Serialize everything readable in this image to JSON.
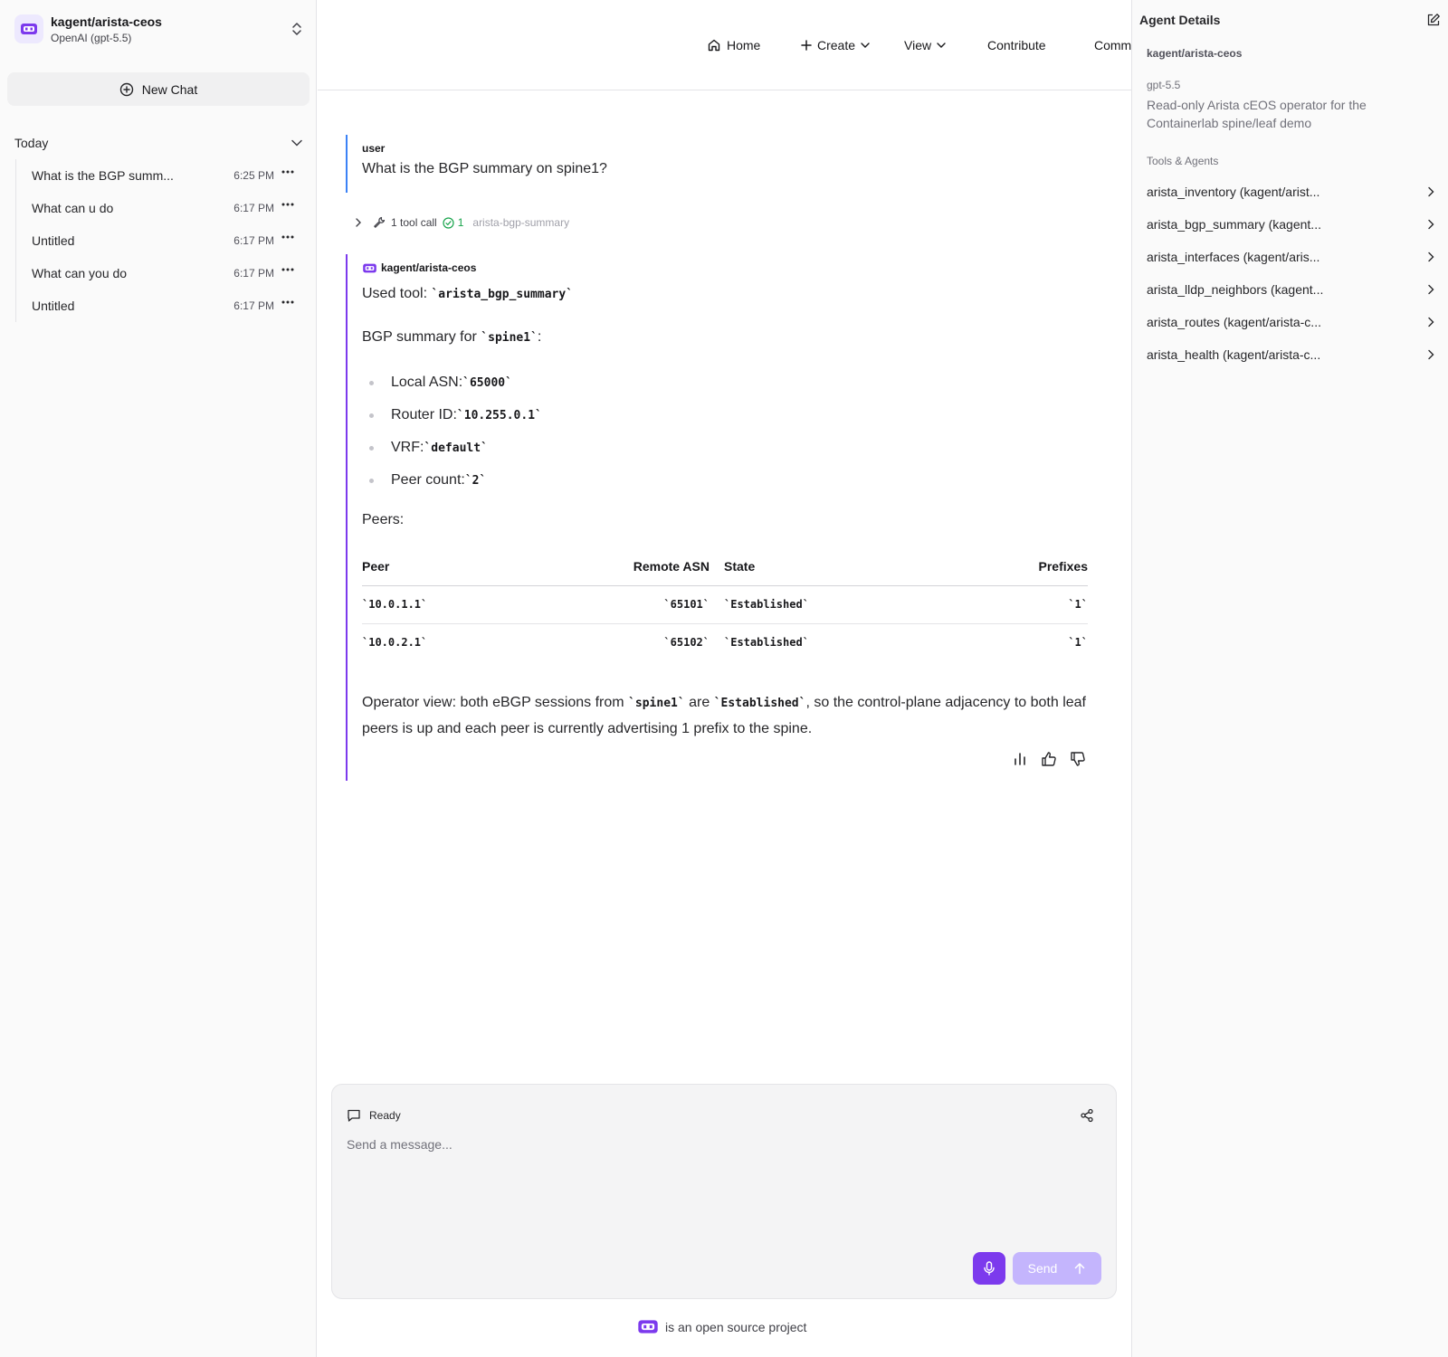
{
  "sidebar": {
    "agent_name": "kagent/arista-ceos",
    "agent_model": "OpenAI (gpt-5.5)",
    "new_chat_label": "New Chat",
    "group_label": "Today",
    "chats": [
      {
        "title": "What is the BGP summ...",
        "time": "6:25 PM"
      },
      {
        "title": "What can u do",
        "time": "6:17 PM"
      },
      {
        "title": "Untitled",
        "time": "6:17 PM"
      },
      {
        "title": "What can you do",
        "time": "6:17 PM"
      },
      {
        "title": "Untitled",
        "time": "6:17 PM"
      }
    ]
  },
  "nav": {
    "home": "Home",
    "create": "Create",
    "view": "View",
    "contribute": "Contribute",
    "community": "Comm"
  },
  "conversation": {
    "user_role": "user",
    "user_text": "What is the BGP summary on spine1?",
    "tool_call_label": "1 tool call",
    "tool_success_count": "1",
    "tool_call_name": "arista-bgp-summary",
    "assistant_name": "kagent/arista-ceos",
    "used_tool_prefix": "Used tool: ",
    "used_tool_code": "`arista_bgp_summary`",
    "summary_prefix": "BGP summary for ",
    "summary_code": "`spine1`",
    "summary_suffix": ":",
    "bullets": [
      {
        "label": "Local ASN: ",
        "value": "`65000`"
      },
      {
        "label": "Router ID: ",
        "value": "`10.255.0.1`"
      },
      {
        "label": "VRF: ",
        "value": "`default`"
      },
      {
        "label": "Peer count: ",
        "value": "`2`"
      }
    ],
    "peers_label": "Peers:",
    "table": {
      "headers": {
        "peer": "Peer",
        "remote_asn": "Remote ASN",
        "state": "State",
        "prefixes": "Prefixes"
      },
      "rows": [
        {
          "peer": "`10.0.1.1`",
          "remote_asn": "`65101`",
          "state": "`Established`",
          "prefixes": "`1`"
        },
        {
          "peer": "`10.0.2.1`",
          "remote_asn": "`65102`",
          "state": "`Established`",
          "prefixes": "`1`"
        }
      ]
    },
    "operator_prefix": "Operator view: both eBGP sessions from ",
    "operator_code1": "`spine1`",
    "operator_mid": " are ",
    "operator_code2": "`Established`",
    "operator_suffix": ", so the control-plane adjacency to both leaf peers is up and each peer is currently advertising 1 prefix to the spine."
  },
  "composer": {
    "status": "Ready",
    "placeholder": "Send a message...",
    "send_label": "Send"
  },
  "footer": {
    "text": "is an open source project"
  },
  "details": {
    "title": "Agent Details",
    "agent_name": "kagent/arista-ceos",
    "model": "gpt-5.5",
    "description": "Read-only Arista cEOS operator for the Containerlab spine/leaf demo",
    "tools_label": "Tools & Agents",
    "tools": [
      "arista_inventory (kagent/arist...",
      "arista_bgp_summary (kagent...",
      "arista_interfaces (kagent/aris...",
      "arista_lldp_neighbors (kagent...",
      "arista_routes (kagent/arista-c...",
      "arista_health (kagent/arista-c..."
    ]
  },
  "colors": {
    "accent": "#7c3aed",
    "user_border": "#3b82f6",
    "success": "#16a34a",
    "send_disabled": "#c4b5fd"
  },
  "icons": [
    "robot-logo-icon",
    "chevron-up-down-icon",
    "plus-circle-icon",
    "chevron-down-icon",
    "more-horizontal-icon",
    "home-icon",
    "plus-icon",
    "chevron-right-icon",
    "wrench-icon",
    "check-circle-icon",
    "bar-chart-icon",
    "thumbs-up-icon",
    "thumbs-down-icon",
    "message-square-icon",
    "share-icon",
    "mic-icon",
    "arrow-up-icon",
    "edit-icon"
  ]
}
